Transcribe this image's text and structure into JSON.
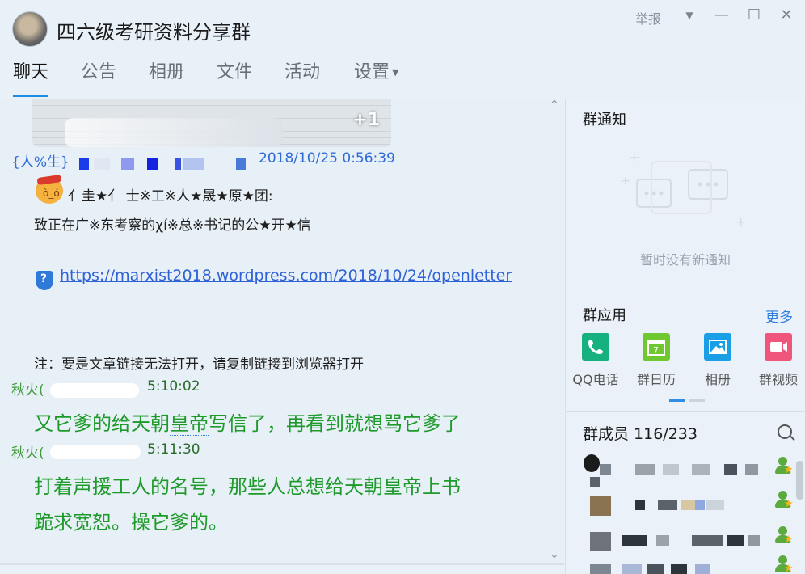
{
  "window": {
    "title": "四六级考研资料分享群",
    "report_label": "举报",
    "dropdown_icon": "▼",
    "min_icon": "—",
    "max_icon": "☐",
    "close_icon": "✕"
  },
  "tabs": [
    {
      "label": "聊天",
      "active": true
    },
    {
      "label": "公告"
    },
    {
      "label": "相册"
    },
    {
      "label": "文件"
    },
    {
      "label": "活动"
    },
    {
      "label": "设置"
    }
  ],
  "chat": {
    "thumb_badge": "+1",
    "messages": [
      {
        "sender": "{人%生}",
        "time": "2018/10/25 0:56:39",
        "line1": "亻圭★亻 士※工※人★晟★原★团:",
        "line2": "致正在广※东考察的χí※总※书记的公★开★信",
        "link": "https://marxist2018.wordpress.com/2018/10/24/openletter",
        "note": "注：要是文章链接无法打开，请复制链接到浏览器打开"
      },
      {
        "sender": "秋火(",
        "time": "5:10:02",
        "text_a": "又它爹的给天朝",
        "text_b": "皇帝",
        "text_c": "写信了，再看到就想骂它爹了"
      },
      {
        "sender": "秋火(",
        "time": "5:11:30",
        "text_line1": "打着声援工人的名号，那些人总想给天朝皇帝上书",
        "text_line2": "跪求宽恕。操它爹的。"
      }
    ]
  },
  "right_panel": {
    "notice": {
      "title": "群通知",
      "empty_text": "暂时没有新通知"
    },
    "apps": {
      "title": "群应用",
      "more_label": "更多",
      "items": [
        {
          "label": "QQ电话",
          "color": "#17b07f",
          "icon": "phone-icon"
        },
        {
          "label": "群日历",
          "color": "#6fc82f",
          "icon": "calendar-icon"
        },
        {
          "label": "相册",
          "color": "#1a9ee6",
          "icon": "photo-icon"
        },
        {
          "label": "群视频",
          "color": "#f0567b",
          "icon": "video-icon"
        }
      ]
    },
    "members": {
      "title": "群成员 116/233"
    }
  },
  "colors": {
    "accent": "#1d8de0",
    "link": "#2e62d6",
    "green_msg": "#1d9a2a"
  }
}
